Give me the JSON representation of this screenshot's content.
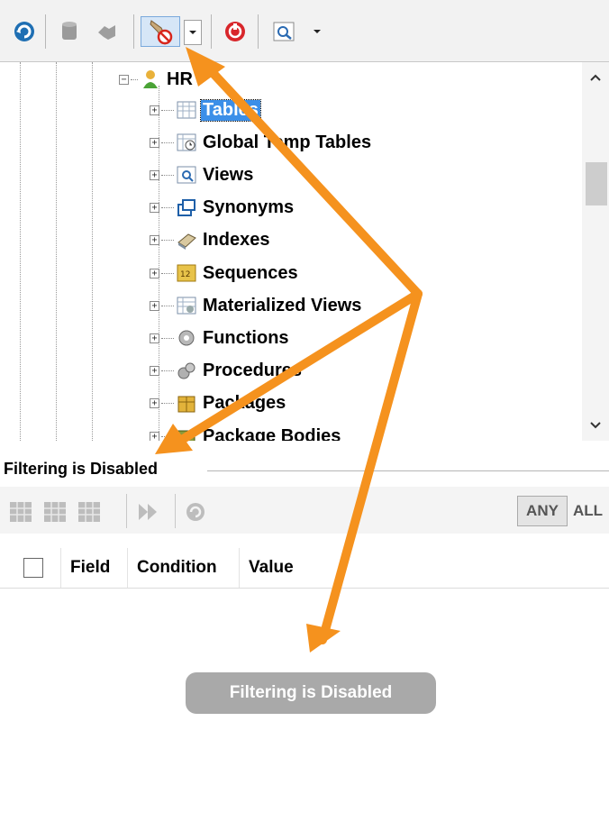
{
  "toolbar": {
    "icons": [
      "refresh-icon",
      "database-icon",
      "connect-icon",
      "filter-disabled-icon",
      "dropdown-arrow-icon",
      "stop-icon",
      "search-icon",
      "dropdown-arrow-icon"
    ]
  },
  "tree": {
    "root_label": "HR",
    "items": [
      {
        "label": "Tables",
        "icon": "table-icon",
        "selected": true
      },
      {
        "label": "Global Temp Tables",
        "icon": "temp-table-icon"
      },
      {
        "label": "Views",
        "icon": "view-icon"
      },
      {
        "label": "Synonyms",
        "icon": "synonym-icon"
      },
      {
        "label": "Indexes",
        "icon": "index-icon"
      },
      {
        "label": "Sequences",
        "icon": "sequence-icon"
      },
      {
        "label": "Materialized Views",
        "icon": "materialized-view-icon"
      },
      {
        "label": "Functions",
        "icon": "function-icon"
      },
      {
        "label": "Procedures",
        "icon": "procedure-icon"
      },
      {
        "label": "Packages",
        "icon": "package-icon"
      },
      {
        "label": "Package Bodies",
        "icon": "package-body-icon"
      }
    ]
  },
  "filter": {
    "title": "Filtering is Disabled",
    "any_label": "ANY",
    "all_label": "ALL",
    "columns": [
      "Field",
      "Condition",
      "Value"
    ],
    "empty_message": "Filtering is Disabled"
  },
  "colors": {
    "selection": "#3c8fe8",
    "arrow": "#f5921e",
    "pill": "#a9a9a9"
  }
}
